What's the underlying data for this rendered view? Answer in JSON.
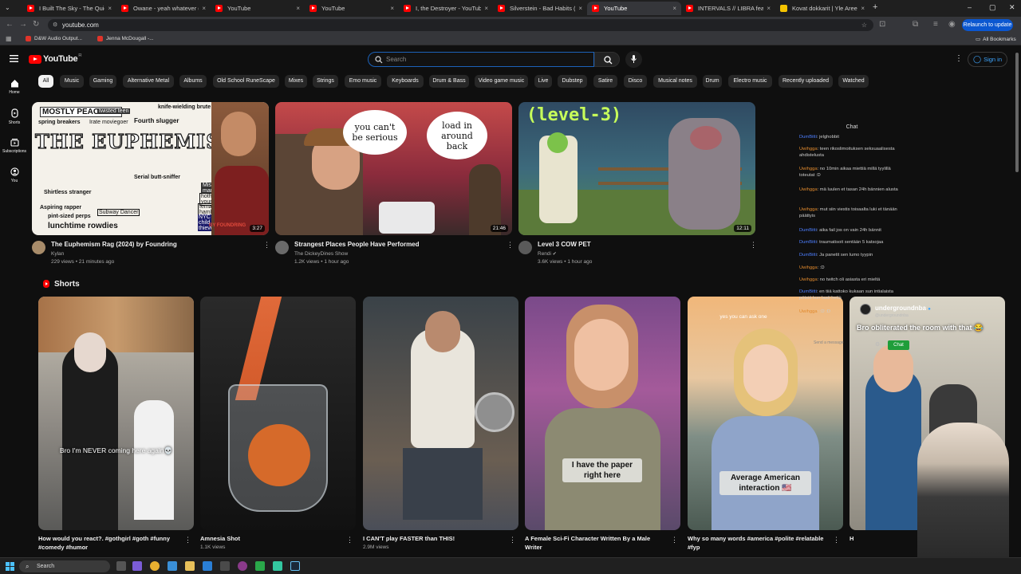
{
  "browser": {
    "tabs": [
      {
        "label": "I Built The Sky - The Quiet Plac",
        "favicon": "youtube-icon"
      },
      {
        "label": "Owane - yeah whatever (Full A",
        "favicon": "youtube-icon"
      },
      {
        "label": "YouTube",
        "favicon": "youtube-icon"
      },
      {
        "label": "YouTube",
        "favicon": "youtube-icon"
      },
      {
        "label": "I, the Destroyer - YouTube",
        "favicon": "youtube-icon"
      },
      {
        "label": "Silverstein - Bad Habits (Offi",
        "favicon": "youtube-icon"
      },
      {
        "label": "YouTube",
        "favicon": "youtube-icon"
      },
      {
        "label": "INTERVALS // LIBRA feat. Plini",
        "favicon": "youtube-icon"
      },
      {
        "label": "Kovat dokkarit | Yle Areena",
        "favicon": "yle-icon"
      }
    ],
    "new_tab": "+",
    "url": "youtube.com",
    "relaunch_label": "Relaunch to update",
    "bookmarks": [
      "D&W Audio Output...",
      "Jenna McDougall -..."
    ],
    "all_bookmarks": "All Bookmarks"
  },
  "masthead": {
    "logo_text": "YouTube",
    "logo_country": "FI",
    "search_placeholder": "Search",
    "sign_in": "Sign in"
  },
  "guide": [
    {
      "label": "Home",
      "icon": "home-icon"
    },
    {
      "label": "Shorts",
      "icon": "shorts-icon"
    },
    {
      "label": "Subscriptions",
      "icon": "subscriptions-icon"
    },
    {
      "label": "You",
      "icon": "you-icon"
    }
  ],
  "chips": [
    "All",
    "Music",
    "Gaming",
    "Alternative Metal",
    "Albums",
    "Old School RuneScape",
    "Mixes",
    "Strings",
    "Emo music",
    "Keyboards",
    "Drum & Bass",
    "Video game music",
    "Live",
    "Dubstep",
    "Satire",
    "Disco",
    "Musical notes",
    "Drum",
    "Electro music",
    "Recently uploaded",
    "Watched"
  ],
  "videos": [
    {
      "title": "The Euphemism Rag (2024) by Foundring",
      "channel": "Kylan",
      "meta": "229 views • 21 minutes ago",
      "duration": "3:27",
      "thumb_heading": "THE EUPHEMISM RAG",
      "thumb_words": [
        "MOSTLY PEACEFUL",
        "twisted teen",
        "knife-wielding brute",
        "spring breakers",
        "Irate moviegoer",
        "Fourth slugger",
        "Serial butt-sniffer",
        "Misogynistic maniac",
        "hotheaded youngsters",
        "female hamburglars",
        "NYC child thieves",
        "lunchtime rowdies",
        "Subway Dancer",
        "Shirtless stranger",
        "Aspiring rapper",
        "pint-sized perps"
      ],
      "thumb_brand": "BY FOUNDRING"
    },
    {
      "title": "Strangest Places People Have Performed",
      "channel": "The DickeyDines Show",
      "meta": "1.2K views • 1 hour ago",
      "duration": "21:46",
      "bubble_left": "you can't be serious",
      "bubble_right": "load in around back"
    },
    {
      "title": "Level 3 COW PET",
      "channel": "Rendi",
      "meta": "3.6K views • 1 hour ago",
      "duration": "12:11",
      "thumb_text": "(level-3)"
    }
  ],
  "shorts": {
    "header": "Shorts",
    "items": [
      {
        "title": "How would you react?. #gothgirl #goth #funny #comedy #humor",
        "views": "",
        "caption": "Bro I'm NEVER coming here again💀"
      },
      {
        "title": "Amnesia Shot",
        "views": "1.1K views",
        "caption": ""
      },
      {
        "title": "I CAN'T play FASTER than THIS!",
        "views": "2.9M views",
        "caption": ""
      },
      {
        "title": "A Female Sci-Fi Character Written By a Male Writer",
        "views": "",
        "caption": "I have the paper right here"
      },
      {
        "title": "Why so many words #america #polite #relatable #fyp",
        "views": "",
        "caption": "Average American interaction 🇺🇸",
        "top_caption": "yes you can ask one"
      },
      {
        "title": "H",
        "views": "",
        "caption": ""
      }
    ]
  },
  "chat": {
    "title": "Chat",
    "messages": [
      {
        "user": "DumBitti",
        "text": "jelghobbit"
      },
      {
        "user": "Uwihgga",
        "text": "teen rikoslimoituksen seksuaalisesta ahdistelusta"
      },
      {
        "user": "Uwihgga",
        "text": "no 10min aikaa miettiä millä tyylillä toteutat :D"
      },
      {
        "user": "Uwihgga",
        "text": "mä luulen et tasan 24h bännien alusta"
      },
      {
        "user": "Uwihgga",
        "text": "mut siin viestis toisaalta luki et tänään päättyis"
      },
      {
        "user": "DumBitti",
        "text": "aika fail jos on vain 24h bännit"
      },
      {
        "user": "DumBitti",
        "text": "traumatisoit sentään 5 katsojaa"
      },
      {
        "user": "DumBitti",
        "text": "Ja panetit sen lumo tyypin"
      },
      {
        "user": "Uwihgga",
        "text": ":D"
      },
      {
        "user": "Uwihgga",
        "text": "no twitch oli asiasta eri mieltä"
      },
      {
        "user": "DumBitti",
        "text": "en tiiä kattoko kukaan sun intialaista pötsiä kun laati hetiä"
      },
      {
        "user": "Uwihgga",
        "text": ":D :D"
      }
    ],
    "send_placeholder": "Send a message",
    "chat_button": "Chat"
  },
  "short_overlay": {
    "name": "undergroundnba",
    "handle": "@undergroundnba",
    "comment": "Bro obliterated the room with that 😂"
  },
  "taskbar": {
    "search_label": "Search"
  },
  "colors": {
    "background": "#0f0f0f",
    "youtube_red": "#ff0000",
    "link_blue": "#3ea6ff",
    "search_focus": "#1c62b9"
  }
}
